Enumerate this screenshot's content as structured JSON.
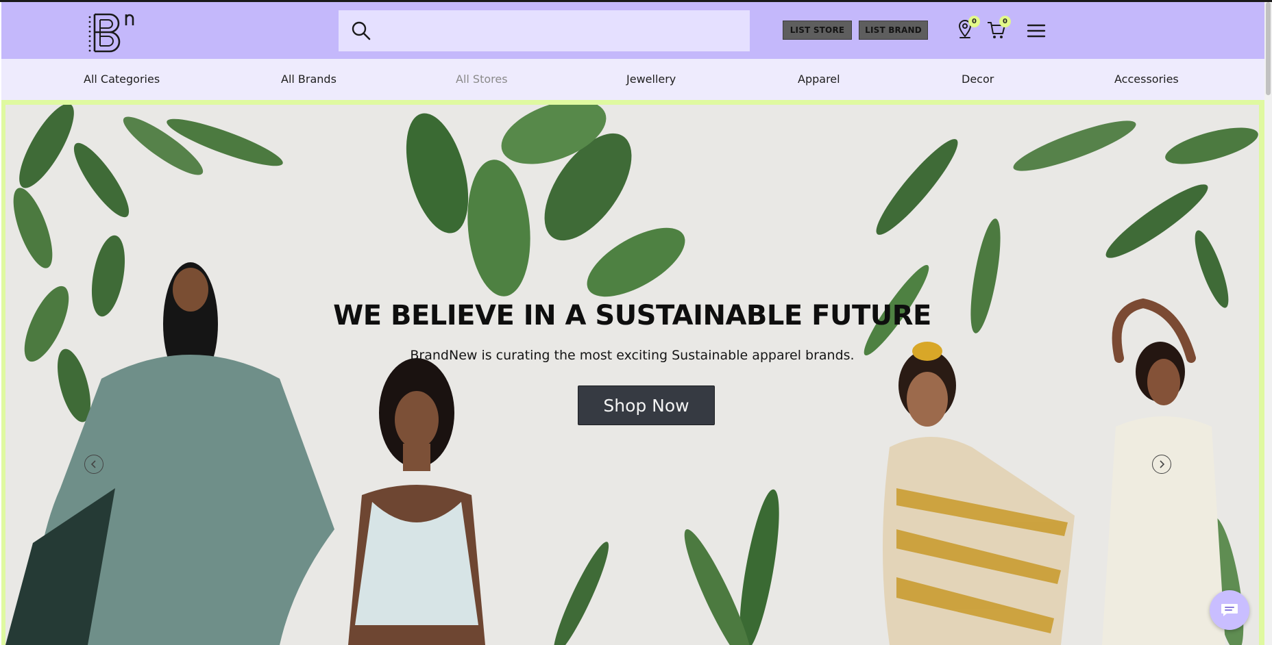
{
  "header": {
    "logo_icon": "brandnew-logo",
    "search": {
      "placeholder": "",
      "value": "",
      "icon": "search-icon"
    },
    "buttons": {
      "list_store": "LIST STORE",
      "list_brand": "LIST BRAND"
    },
    "location": {
      "icon": "location-pin-icon",
      "count": "0"
    },
    "cart": {
      "icon": "cart-icon",
      "count": "0"
    },
    "menu_icon": "hamburger-menu-icon",
    "accent_color": "#c4b8fb",
    "badge_color": "#e2f98a"
  },
  "nav": {
    "items": [
      {
        "label": "All Categories"
      },
      {
        "label": "All Brands"
      },
      {
        "label": "All Stores"
      },
      {
        "label": "Jewellery"
      },
      {
        "label": "Apparel"
      },
      {
        "label": "Decor"
      },
      {
        "label": "Accessories"
      }
    ]
  },
  "hero": {
    "title": "WE BELIEVE IN A SUSTAINABLE FUTURE",
    "subtitle": "BrandNew is curating the most exciting Sustainable apparel brands.",
    "cta": "Shop Now",
    "prev_icon": "chevron-left-icon",
    "next_icon": "chevron-right-icon",
    "border_color": "#dff9a0"
  },
  "chat": {
    "icon": "chat-bubble-icon"
  }
}
